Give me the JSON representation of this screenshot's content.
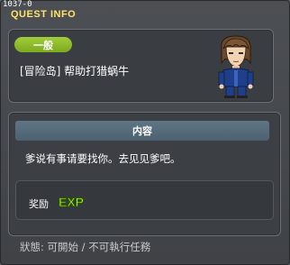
{
  "window": {
    "quest_id": "1037-0",
    "title": "QUEST INFO"
  },
  "quest": {
    "category_badge": "一般",
    "name": "[冒险岛] 帮助打猎蜗牛"
  },
  "content": {
    "header": "内容",
    "description": "爹说有事请要找你。去见见爹吧。"
  },
  "reward": {
    "label": "奖励",
    "exp_text": "EXP"
  },
  "status": {
    "text": "狀態: 可開始 / 不可執行任務"
  },
  "colors": {
    "title": "#ffe46a",
    "badge": "#8ebc2a",
    "exp": "#b6ff2e",
    "section_header": "#56697a"
  }
}
